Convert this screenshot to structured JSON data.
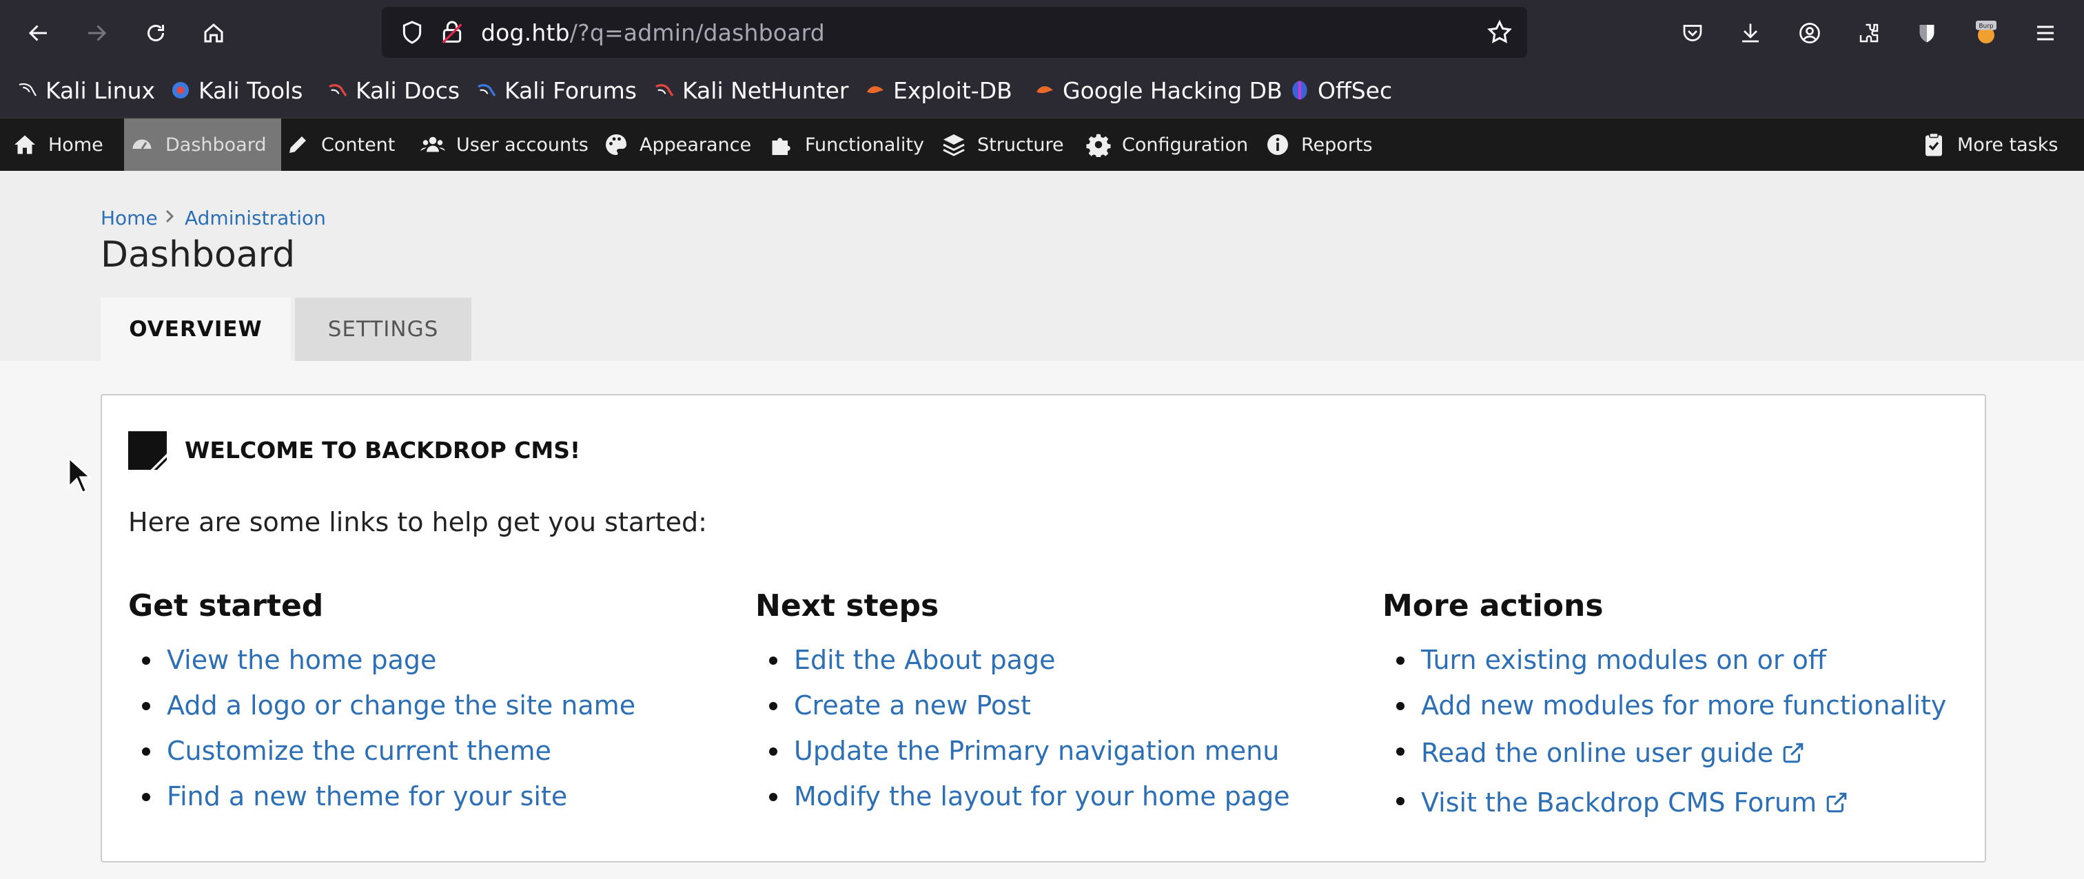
{
  "browser": {
    "url_host": "dog.htb",
    "url_path": "/?q=admin/dashboard",
    "bookmarks": [
      {
        "label": "Kali Linux",
        "icon": "kali-dragon-icon"
      },
      {
        "label": "Kali Tools",
        "icon": "kali-tools-icon"
      },
      {
        "label": "Kali Docs",
        "icon": "kali-docs-icon"
      },
      {
        "label": "Kali Forums",
        "icon": "kali-forums-icon"
      },
      {
        "label": "Kali NetHunter",
        "icon": "kali-nethunter-icon"
      },
      {
        "label": "Exploit-DB",
        "icon": "exploit-db-icon"
      },
      {
        "label": "Google Hacking DB",
        "icon": "ghdb-icon"
      },
      {
        "label": "OffSec",
        "icon": "offsec-icon"
      }
    ],
    "burp_badge": "Burp"
  },
  "adminbar": {
    "items": [
      {
        "label": "Home",
        "icon": "home-icon"
      },
      {
        "label": "Dashboard",
        "icon": "dashboard-icon",
        "active": true
      },
      {
        "label": "Content",
        "icon": "pencil-icon"
      },
      {
        "label": "User accounts",
        "icon": "users-icon"
      },
      {
        "label": "Appearance",
        "icon": "palette-icon"
      },
      {
        "label": "Functionality",
        "icon": "puzzle-icon"
      },
      {
        "label": "Structure",
        "icon": "layers-icon"
      },
      {
        "label": "Configuration",
        "icon": "gear-icon"
      },
      {
        "label": "Reports",
        "icon": "info-icon"
      }
    ],
    "more_tasks": "More tasks"
  },
  "breadcrumb": {
    "home": "Home",
    "admin": "Administration"
  },
  "page_title": "Dashboard",
  "tabs": {
    "overview": "OVERVIEW",
    "settings": "SETTINGS"
  },
  "welcome": {
    "title": "WELCOME TO BACKDROP CMS!",
    "intro": "Here are some links to help get you started:",
    "columns": [
      {
        "heading": "Get started",
        "links": [
          "View the home page",
          "Add a logo or change the site name",
          "Customize the current theme",
          "Find a new theme for your site"
        ]
      },
      {
        "heading": "Next steps",
        "links": [
          "Edit the About page",
          "Create a new Post",
          "Update the Primary navigation menu",
          "Modify the layout for your home page"
        ]
      },
      {
        "heading": "More actions",
        "links": [
          "Turn existing modules on or off",
          "Add new modules for more functionality",
          "Read the online user guide",
          "Visit the Backdrop CMS Forum"
        ]
      }
    ]
  },
  "colors": {
    "link": "#2d6fb4",
    "adminbar": "#1a1a1a",
    "chrome": "#2b2a33"
  }
}
